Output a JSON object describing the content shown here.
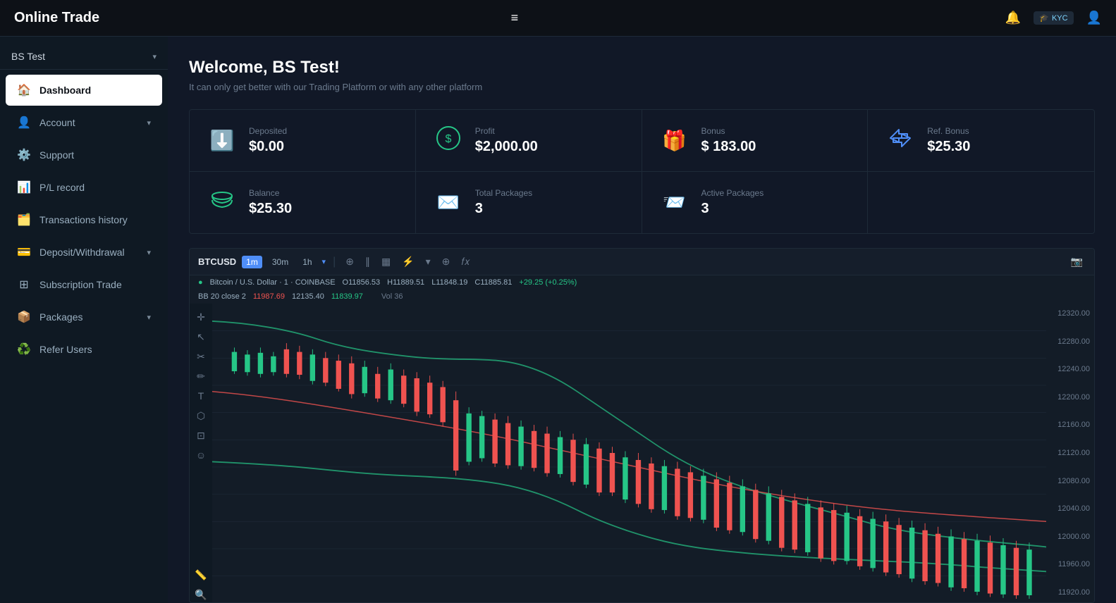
{
  "app": {
    "title": "Online Trade",
    "hamburger": "≡"
  },
  "topnav": {
    "notification_icon": "🔔",
    "kyc_label": "KYC",
    "profile_icon": "👤"
  },
  "sidebar": {
    "account_name": "BS Test",
    "items": [
      {
        "id": "dashboard",
        "label": "Dashboard",
        "icon": "🏠",
        "active": true
      },
      {
        "id": "account",
        "label": "Account",
        "icon": "👤",
        "arrow": "▾"
      },
      {
        "id": "support",
        "label": "Support",
        "icon": "⚙️"
      },
      {
        "id": "pl-record",
        "label": "P/L record",
        "icon": "📊"
      },
      {
        "id": "transactions",
        "label": "Transactions history",
        "icon": "🗂️"
      },
      {
        "id": "deposit",
        "label": "Deposit/Withdrawal",
        "icon": "💳",
        "arrow": "▾"
      },
      {
        "id": "subscription",
        "label": "Subscription Trade",
        "icon": "⊞"
      },
      {
        "id": "packages",
        "label": "Packages",
        "icon": "📦",
        "arrow": "▾"
      },
      {
        "id": "refer",
        "label": "Refer Users",
        "icon": "♻️"
      }
    ]
  },
  "welcome": {
    "title": "Welcome, BS Test!",
    "subtitle": "It can only get better with our Trading Platform or with any other platform"
  },
  "stats": [
    {
      "label": "Deposited",
      "value": "$0.00",
      "icon": "⬇️",
      "icon_color": "#f59e0b"
    },
    {
      "label": "Profit",
      "value": "$2,000.00",
      "icon": "💰",
      "icon_color": "#26c687"
    },
    {
      "label": "Bonus",
      "value": "$ 183.00",
      "icon": "🎁",
      "icon_color": "#ef5350"
    },
    {
      "label": "Ref. Bonus",
      "value": "$25.30",
      "icon": "🔄",
      "icon_color": "#4f8ef7"
    },
    {
      "label": "Balance",
      "value": "$25.30",
      "icon": "💚",
      "icon_color": "#26c687"
    },
    {
      "label": "Total Packages",
      "value": "3",
      "icon": "✉️",
      "icon_color": "#ef5350"
    },
    {
      "label": "Active Packages",
      "value": "3",
      "icon": "📨",
      "icon_color": "#4f8ef7"
    }
  ],
  "chart": {
    "symbol": "BTCUSD",
    "timeframes": [
      "1m",
      "30m",
      "1h"
    ],
    "active_tf": "1m",
    "pair_label": "Bitcoin / U.S. Dollar · 1 · COINBASE",
    "dot_color": "#26c687",
    "open": "O11856.53",
    "high": "H11889.51",
    "low": "L11848.19",
    "close": "C11885.81",
    "change": "+29.25 (+0.25%)",
    "bb_label": "BB 20 close 2",
    "bb_val1": "11987.69",
    "bb_val2": "12135.40",
    "bb_val3": "11839.97",
    "vol_label": "Vol 36",
    "price_scale": [
      "12320.00",
      "12280.00",
      "12240.00",
      "12200.00",
      "12160.00",
      "12120.00",
      "12080.00",
      "12040.00",
      "12000.00",
      "11960.00",
      "11920.00"
    ]
  }
}
